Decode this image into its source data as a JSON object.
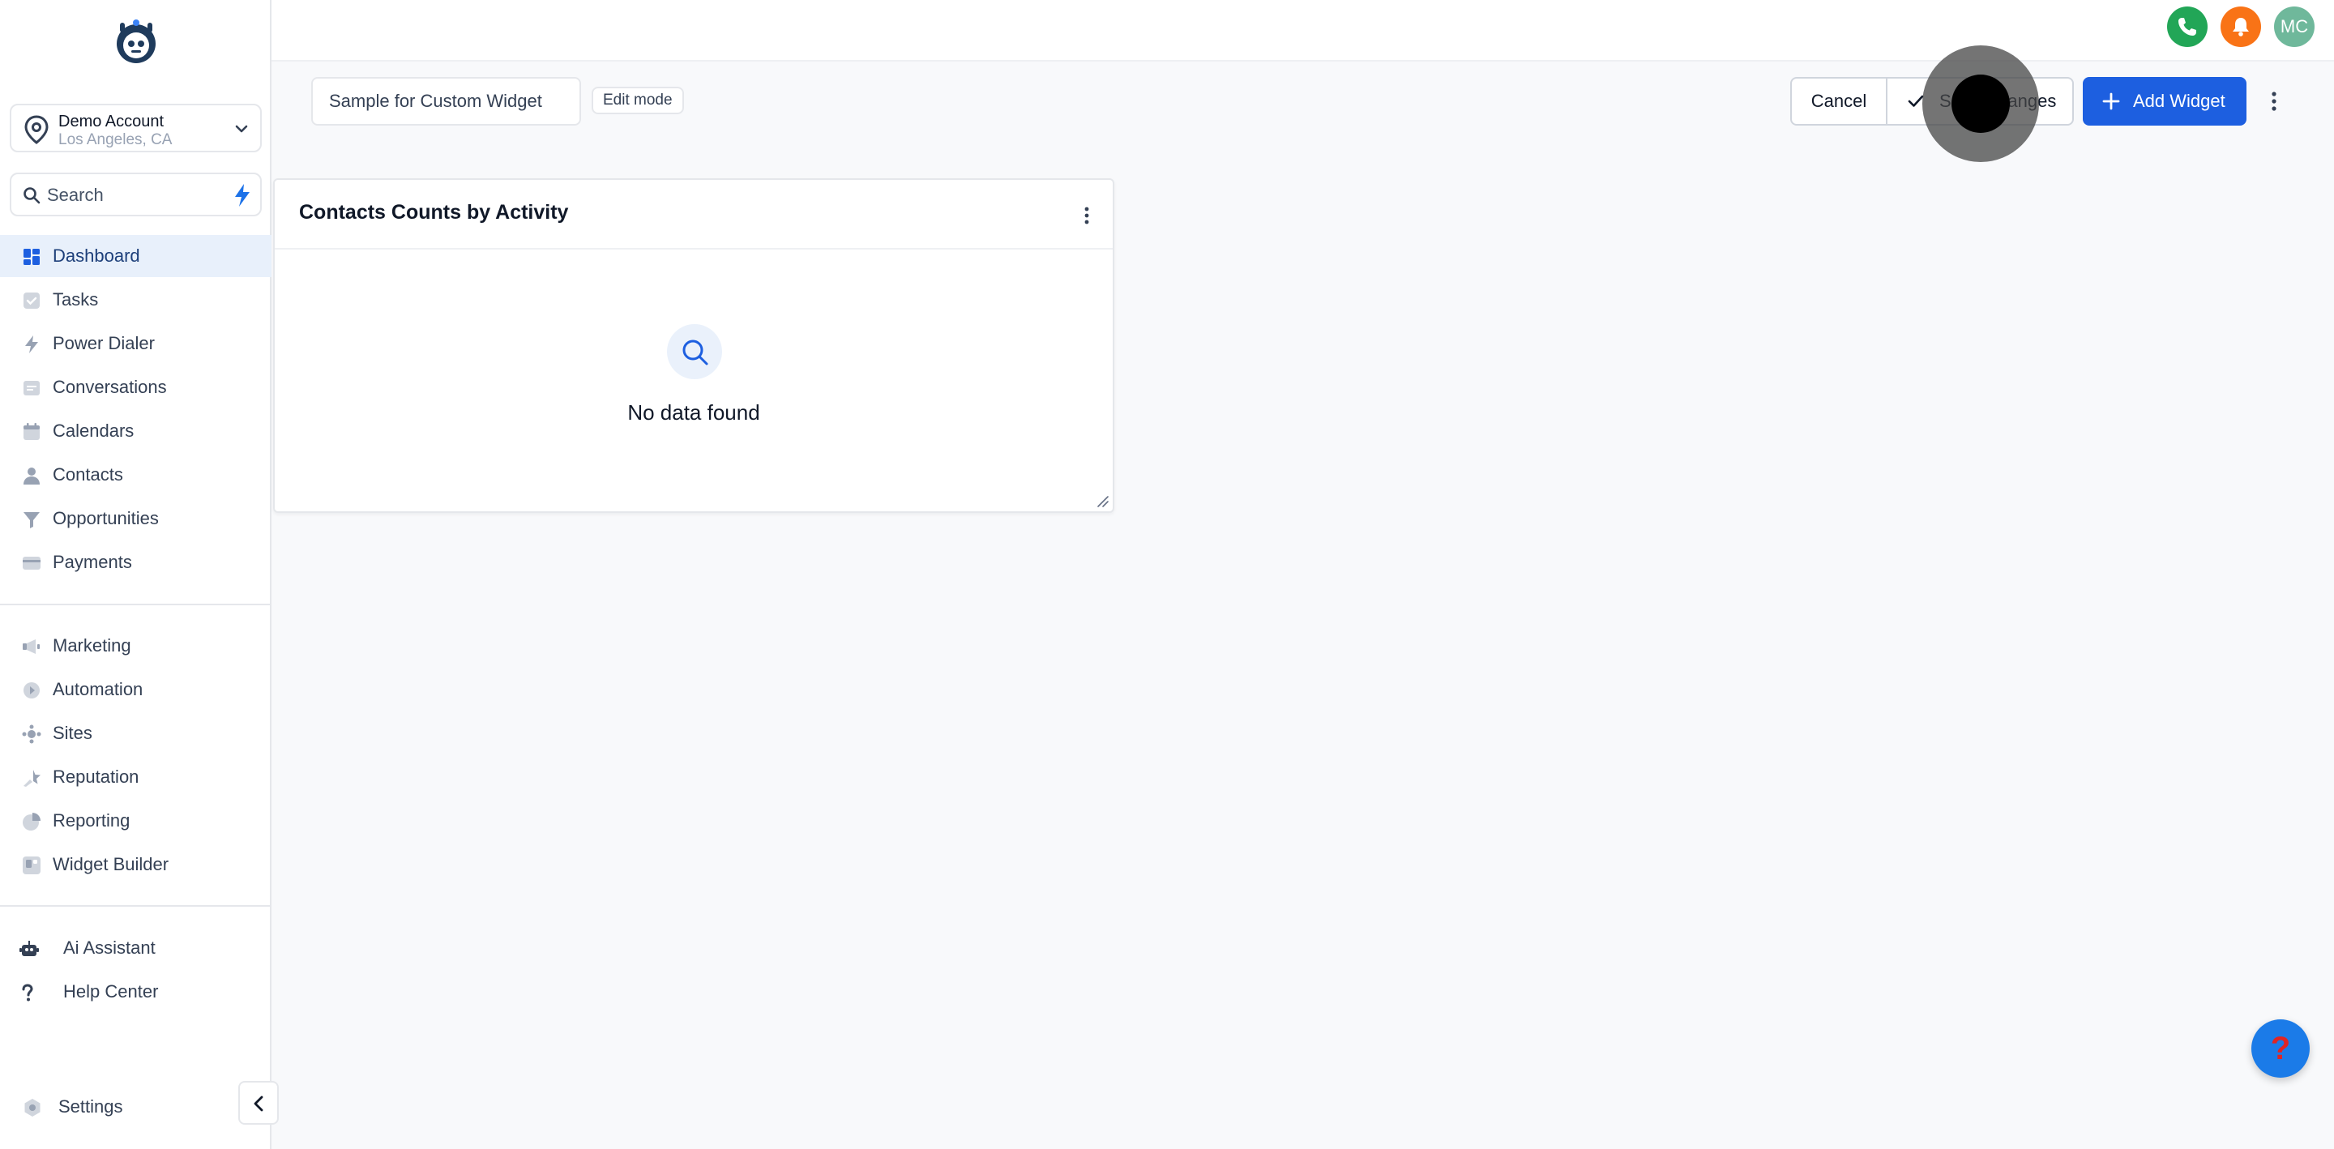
{
  "account": {
    "name": "Demo Account",
    "location": "Los Angeles, CA"
  },
  "search": {
    "placeholder": "Search"
  },
  "sidebar": {
    "primary": [
      {
        "label": "Dashboard",
        "icon": "dashboard-icon",
        "active": true
      },
      {
        "label": "Tasks",
        "icon": "tasks-icon"
      },
      {
        "label": "Power Dialer",
        "icon": "power-dialer-icon"
      },
      {
        "label": "Conversations",
        "icon": "conversations-icon"
      },
      {
        "label": "Calendars",
        "icon": "calendar-icon"
      },
      {
        "label": "Contacts",
        "icon": "contacts-icon"
      },
      {
        "label": "Opportunities",
        "icon": "opportunities-icon"
      },
      {
        "label": "Payments",
        "icon": "payments-icon"
      }
    ],
    "secondary": [
      {
        "label": "Marketing",
        "icon": "marketing-icon"
      },
      {
        "label": "Automation",
        "icon": "automation-icon"
      },
      {
        "label": "Sites",
        "icon": "sites-icon"
      },
      {
        "label": "Reputation",
        "icon": "reputation-icon"
      },
      {
        "label": "Reporting",
        "icon": "reporting-icon"
      },
      {
        "label": "Widget Builder",
        "icon": "widget-builder-icon"
      }
    ],
    "tertiary": [
      {
        "label": "Ai Assistant",
        "icon": "robot-icon"
      },
      {
        "label": "Help Center",
        "icon": "question-icon"
      }
    ],
    "settings_label": "Settings"
  },
  "topbar": {
    "avatar_initials": "MC"
  },
  "toolbar": {
    "dashboard_name": "Sample for Custom Widget",
    "mode_badge": "Edit mode",
    "cancel_label": "Cancel",
    "save_label": "Save Changes",
    "add_label": "Add Widget"
  },
  "widget": {
    "title": "Contacts Counts by Activity",
    "empty_text": "No data found"
  },
  "help_fab": {
    "glyph": "?"
  },
  "colors": {
    "primary": "#1d5fe0",
    "active_nav_bg": "#e8f0fb",
    "phone": "#22a657",
    "bell": "#f97316",
    "avatar": "#6fb89b"
  }
}
